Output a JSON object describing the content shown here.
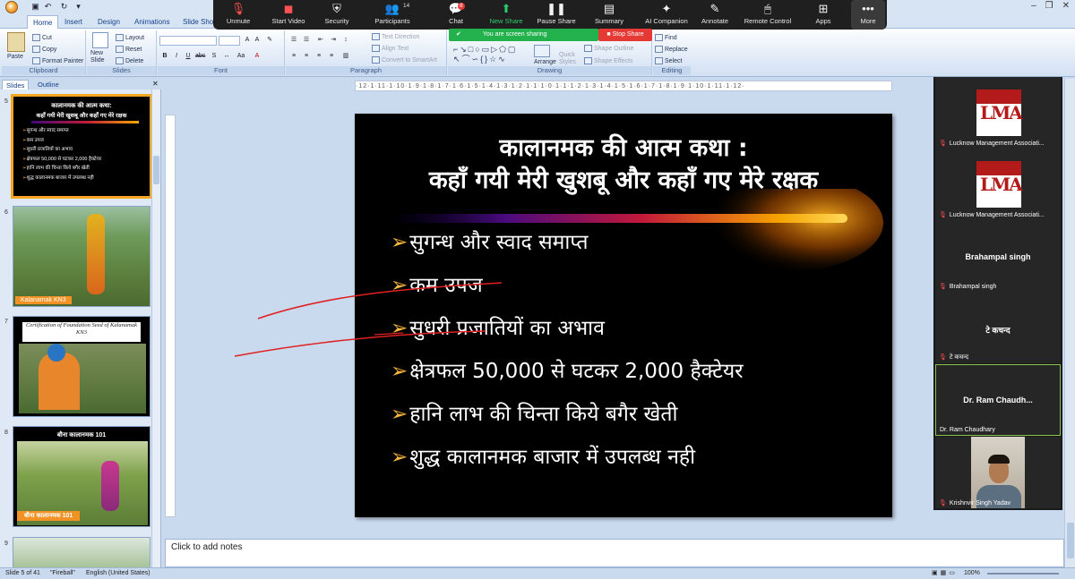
{
  "office": {
    "tabs": [
      "Home",
      "Insert",
      "Design",
      "Animations",
      "Slide Show"
    ],
    "active_tab": "Home",
    "clipboard": {
      "paste": "Paste",
      "cut": "Cut",
      "copy": "Copy",
      "format_painter": "Format Painter",
      "label": "Clipboard"
    },
    "slides": {
      "new_slide": "New Slide",
      "layout": "Layout",
      "reset": "Reset",
      "delete": "Delete",
      "label": "Slides"
    },
    "font": {
      "label": "Font"
    },
    "paragraph": {
      "text_direction": "Text Direction",
      "align_text": "Align Text",
      "convert_smartart": "Convert to SmartArt",
      "label": "Paragraph"
    },
    "drawing": {
      "arrange": "Arrange",
      "quick_styles": "Quick Styles",
      "shape_fill": "Shape Fill",
      "shape_outline": "Shape Outline",
      "shape_effects": "Shape Effects",
      "label": "Drawing"
    },
    "editing": {
      "find": "Find",
      "replace": "Replace",
      "select": "Select",
      "label": "Editing"
    }
  },
  "zoom": {
    "buttons": [
      {
        "label": "Unmute",
        "icon": "mic-off-icon"
      },
      {
        "label": "Start Video",
        "icon": "video-off-icon"
      },
      {
        "label": "Security",
        "icon": "shield-icon"
      },
      {
        "label": "Participants",
        "icon": "people-icon",
        "badge": "14"
      },
      {
        "label": "Chat",
        "icon": "chat-icon",
        "badge": "8"
      },
      {
        "label": "New Share",
        "icon": "share-icon"
      },
      {
        "label": "Pause Share",
        "icon": "pause-icon"
      },
      {
        "label": "Summary",
        "icon": "summary-icon"
      },
      {
        "label": "AI Companion",
        "icon": "sparkle-icon"
      },
      {
        "label": "Annotate",
        "icon": "pen-icon"
      },
      {
        "label": "Remote Control",
        "icon": "remote-icon"
      },
      {
        "label": "Apps",
        "icon": "apps-icon"
      },
      {
        "label": "More",
        "icon": "more-icon"
      }
    ],
    "sharing_text": "You are screen sharing",
    "stop_share": "Stop Share"
  },
  "panel": {
    "tabs": [
      "Slides",
      "Outline"
    ],
    "thumbs": [
      {
        "num": "5",
        "title1": "कालानमक की आत्म कथा:",
        "title2": "कहाँ गयी मेरी खुशबू और कहाँ गए मेरे रक्षक",
        "items": [
          "सुगन्ध और स्वाद समाप्त",
          "कम उपज",
          "सुधरी प्रजातियों का अभाव",
          "क्षेत्रफल 50,000 से घटकर 2,000 हैक्टेयर",
          "हानि लाभ की चिन्ता किये बगैर खेती",
          "शुद्ध कालानमक बाजार में उपलब्ध नही"
        ]
      },
      {
        "num": "6",
        "caption": "Kalanamak  KN3"
      },
      {
        "num": "7",
        "title": "Certification of Foundation Seed of Kalanamak KN3"
      },
      {
        "num": "8",
        "title": "बौना कालानमक 101",
        "caption": "बौना कालानमक 101"
      },
      {
        "num": "9"
      }
    ]
  },
  "slide": {
    "title1": "कालानमक की आत्म कथा :",
    "title2": "कहाँ गयी मेरी खुशबू और कहाँ गए मेरे रक्षक",
    "bullets": [
      "सुगन्ध और स्वाद समाप्त",
      "कम उपज",
      "सुधरी प्रजातियों का अभाव",
      "क्षेत्रफल 50,000 से घटकर 2,000 हैक्टेयर",
      "हानि लाभ की चिन्ता किये बगैर खेती",
      "शुद्ध कालानमक बाजार में उपलब्ध नही"
    ]
  },
  "ruler_text": "·12·1·11·1·10·1·9·1·8·1·7·1·6·1·5·1·4·1·3·1·2·1·1·1·0·1·1·1·2·1·3·1·4·1·5·1·6·1·7·1·8·1·9·1·10·1·11·1·12·",
  "notes_placeholder": "Click to add notes",
  "status": {
    "slide": "Slide 5 of 41",
    "theme": "\"Fireball\"",
    "language": "English (United States)",
    "zoom": "100%"
  },
  "participants": [
    {
      "name": "Lucknow Management Associati...",
      "type": "logo",
      "logo_text": "LMA"
    },
    {
      "name": "Lucknow Management Associati...",
      "type": "logo",
      "logo_text": "LMA"
    },
    {
      "name": "Brahampal singh",
      "center": "Brahampal singh"
    },
    {
      "name": "टे कचन्द",
      "center": "टे कचन्द"
    },
    {
      "name": "Dr. Ram Chaudhary",
      "center": "Dr. Ram  Chaudh..."
    },
    {
      "name": "Krishnvir Singh Yadav",
      "type": "video"
    }
  ]
}
